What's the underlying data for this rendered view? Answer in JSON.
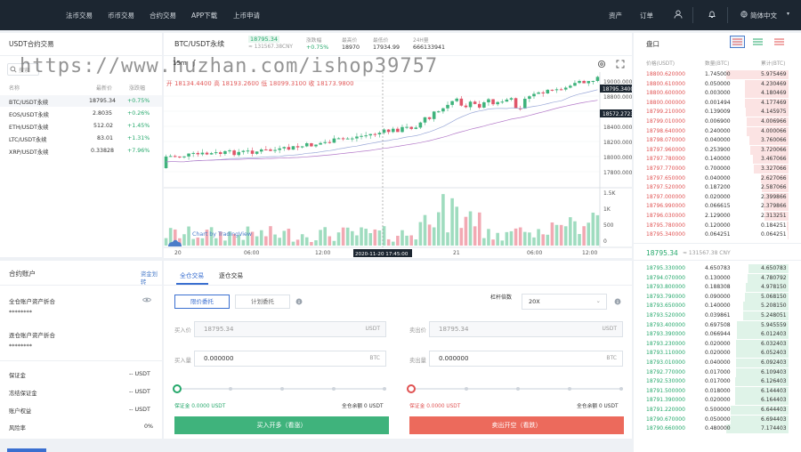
{
  "nav": {
    "items": [
      "法币交易",
      "币币交易",
      "合约交易",
      "APP下载",
      "上币申请"
    ],
    "right": [
      "资产",
      "订单",
      "简体中文"
    ]
  },
  "sidebar": {
    "title": "USDT合约交易",
    "search_placeholder": "搜索",
    "col_name": "名称",
    "col_price": "最新价",
    "col_change": "涨跌幅",
    "rows": [
      {
        "name": "BTC/USDT永续",
        "price": "18795.34",
        "change": "+0.75%"
      },
      {
        "name": "EOS/USDT永续",
        "price": "2.8035",
        "change": "+0.26%"
      },
      {
        "name": "ETH/USDT永续",
        "price": "512.02",
        "change": "+1.45%"
      },
      {
        "name": "LTC/USDT永续",
        "price": "83.01",
        "change": "+1.31%"
      },
      {
        "name": "XRP/USDT永续",
        "price": "0.33828",
        "change": "+7.96%"
      }
    ]
  },
  "ticker": {
    "pair": "BTC/USDT永续",
    "price": "18795.34",
    "cny": "≈ 131567.38CNY",
    "change_label": "涨跌幅",
    "change": "+0.75%",
    "high_label": "最高价",
    "high": "18970",
    "low_label": "最低价",
    "low": "17934.99",
    "vol_label": "24H量",
    "vol": "666133941"
  },
  "chart": {
    "interval": "15m",
    "ohlc": "开 18134.4400 高 18193.2600 低 18099.3100 收 18173.9800",
    "price_ticks": [
      "19000.0000",
      "18800.0000",
      "18600.0000",
      "18400.0000",
      "18200.0000",
      "18000.0000",
      "17800.0000"
    ],
    "price_tag_1": "18795.3400",
    "price_tag_2": "18572.2723",
    "vol_ticks": [
      "1.5K",
      "1K",
      "500",
      "0"
    ],
    "time_ticks": [
      "20",
      "06:00",
      "12:00",
      "18:00",
      "21",
      "06:00",
      "12:00"
    ],
    "crosshair_time": "2020-11-20 17:45:00",
    "brand": "Chart by TradingView"
  },
  "orderbook": {
    "title": "盘口",
    "col_price": "价格(USDT)",
    "col_qty": "数量(BTC)",
    "col_total": "累计(BTC)",
    "asks": [
      [
        "18800.620000",
        "1.745000",
        "5.975469"
      ],
      [
        "18800.610000",
        "0.050000",
        "4.230469"
      ],
      [
        "18800.600000",
        "0.003000",
        "4.180469"
      ],
      [
        "18800.000000",
        "0.001494",
        "4.177469"
      ],
      [
        "18799.210000",
        "0.139009",
        "4.145975"
      ],
      [
        "18799.010000",
        "0.006900",
        "4.006966"
      ],
      [
        "18798.640000",
        "0.240000",
        "4.000066"
      ],
      [
        "18798.070000",
        "0.040000",
        "3.760066"
      ],
      [
        "18797.960000",
        "0.253900",
        "3.720066"
      ],
      [
        "18797.780000",
        "0.140000",
        "3.467066"
      ],
      [
        "18797.770000",
        "0.700000",
        "3.327066"
      ],
      [
        "18797.650000",
        "0.040000",
        "2.627066"
      ],
      [
        "18797.520000",
        "0.187200",
        "2.587066"
      ],
      [
        "18797.000000",
        "0.020000",
        "2.399866"
      ],
      [
        "18796.990000",
        "0.066615",
        "2.379866"
      ],
      [
        "18796.030000",
        "2.129000",
        "2.313251"
      ],
      [
        "18795.780000",
        "0.120000",
        "0.184251"
      ],
      [
        "18795.340000",
        "0.064251",
        "0.064251"
      ]
    ],
    "last_price": "18795.34",
    "last_cny": "≈ 131567.38 CNY",
    "bids": [
      [
        "18795.330000",
        "4.650783",
        "4.650783"
      ],
      [
        "18794.070000",
        "0.130000",
        "4.780792"
      ],
      [
        "18793.800000",
        "0.188308",
        "4.978150"
      ],
      [
        "18793.790000",
        "0.090000",
        "5.068150"
      ],
      [
        "18793.650000",
        "0.140000",
        "5.208150"
      ],
      [
        "18793.520000",
        "0.039861",
        "5.248051"
      ],
      [
        "18793.400000",
        "0.697508",
        "5.945559"
      ],
      [
        "18793.390000",
        "0.066944",
        "6.012403"
      ],
      [
        "18793.230000",
        "0.020000",
        "6.032403"
      ],
      [
        "18793.110000",
        "0.020000",
        "6.052403"
      ],
      [
        "18793.010000",
        "0.040000",
        "6.092403"
      ],
      [
        "18792.770000",
        "0.017000",
        "6.109403"
      ],
      [
        "18792.530000",
        "0.017000",
        "6.126403"
      ],
      [
        "18791.500000",
        "0.018000",
        "6.144403"
      ],
      [
        "18791.390000",
        "0.020000",
        "6.164403"
      ],
      [
        "18791.220000",
        "0.500000",
        "6.644403"
      ],
      [
        "18790.670000",
        "0.050000",
        "6.694403"
      ],
      [
        "18790.660000",
        "0.480000",
        "7.174403"
      ]
    ]
  },
  "account": {
    "title": "合约账户",
    "transfer": "资金划转",
    "total_label": "全仓账户资产折合",
    "total_value": "********",
    "avail_label": "逐仓账户资产折合",
    "avail_value": "********",
    "rows": [
      {
        "label": "保证金",
        "value": "-- USDT"
      },
      {
        "label": "冻结保证金",
        "value": "-- USDT"
      },
      {
        "label": "账户权益",
        "value": "-- USDT"
      },
      {
        "label": "风险率",
        "value": "0%"
      }
    ]
  },
  "trade": {
    "tab_cross": "全仓交易",
    "tab_isolated": "逐仓交易",
    "limit": "限价委托",
    "plan": "计划委托",
    "leverage_label": "杠杆倍数",
    "leverage": "20X",
    "buy_price_label": "买入价",
    "buy_price": "18795.34",
    "sell_price_label": "卖出价",
    "sell_price": "18795.34",
    "unit_usdt": "USDT",
    "buy_qty_label": "买入量",
    "buy_qty": "0.000000",
    "sell_qty_label": "卖出量",
    "sell_qty": "0.000000",
    "unit_btc": "BTC",
    "margin_buy": "保证金 0.0000 USDT",
    "avail_buy": "全仓余额 0 USDT",
    "margin_sell": "保证金 0.0000 USDT",
    "avail_sell": "全仓余额 0 USDT",
    "buy_btn": "买入开多（看涨）",
    "sell_btn": "卖出开空（看跌）"
  },
  "watermark": "https://www.huzhan.com/ishop39757",
  "colors": {
    "up": "#25a86b",
    "down": "#e05252",
    "topbar": "#1c2631"
  }
}
